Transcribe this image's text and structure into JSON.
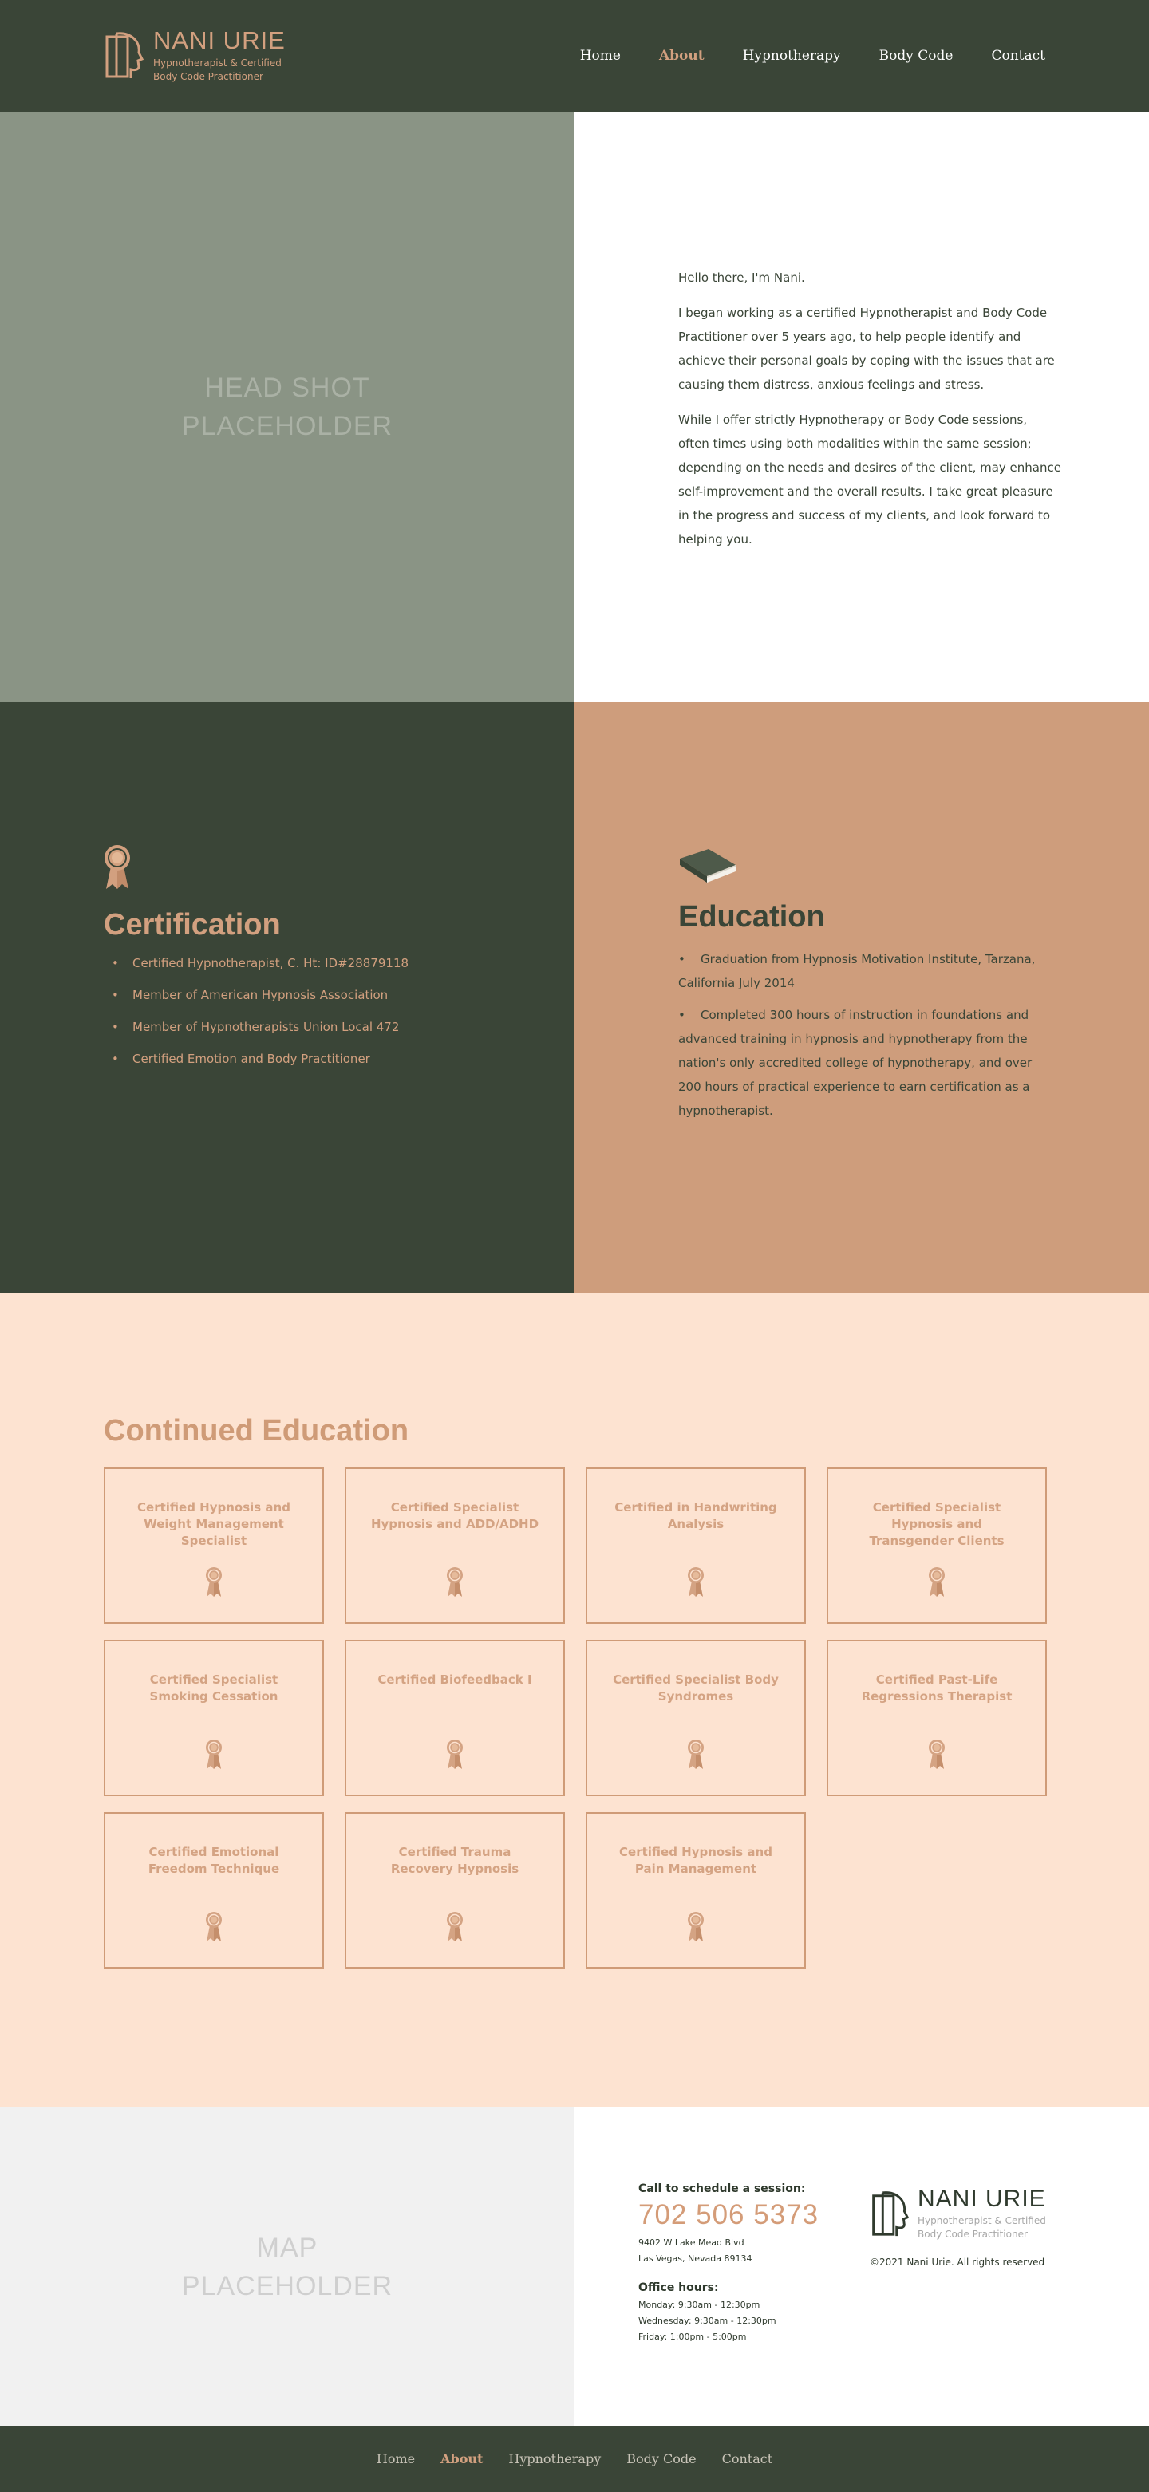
{
  "brand": {
    "name": "NANI URIE",
    "tagline_1": "Hypnotherapist & Certified",
    "tagline_2": "Body Code Practitioner"
  },
  "nav": [
    {
      "label": "Home",
      "active": false
    },
    {
      "label": "About",
      "active": true
    },
    {
      "label": "Hypnotherapy",
      "active": false
    },
    {
      "label": "Body Code",
      "active": false
    },
    {
      "label": "Contact",
      "active": false
    }
  ],
  "intro": {
    "headshot_placeholder": "HEAD SHOT\nPLACEHOLDER",
    "hello": "Hello there, I'm Nani.",
    "paragraph_1": "I began working as a certified Hypnotherapist and Body Code Practitioner over 5 years ago, to help people identify and achieve their personal goals by coping with the issues that are causing them distress, anxious feelings and stress.",
    "paragraph_2": "While I offer strictly Hypnotherapy or Body Code sessions, often times using both modalities within the same session; depending on the needs and desires of the client, may enhance self-improvement and the overall results. I take great pleasure in the progress and success of my clients, and look forward to helping you."
  },
  "certification": {
    "icon": "award-ribbon-icon",
    "title": "Certification",
    "items": [
      "Certified Hypnotherapist, C. Ht: ID#28879118",
      "Member of American Hypnosis Association",
      "Member of Hypnotherapists Union Local 472",
      "Certified Emotion and Body Practitioner"
    ]
  },
  "education": {
    "icon": "book-icon",
    "title": "Education",
    "items": [
      "Graduation from Hypnosis Motivation Institute, Tarzana, California July 2014",
      "Completed 300 hours of instruction in foundations and advanced training in hypnosis and hypnotherapy from the nation's only accredited college of hypnotherapy, and over 200 hours of practical experience to earn certification as a hypnotherapist."
    ]
  },
  "continued_education": {
    "title": "Continued Education",
    "cards": [
      "Certified Hypnosis and Weight Management Specialist",
      "Certified Specialist Hypnosis and ADD/ADHD",
      "Certified in Handwriting Analysis",
      "Certified Specialist Hypnosis and Transgender Clients",
      "Certified Specialist Smoking Cessation",
      "Certified Biofeedback I",
      "Certified Specialist Body Syndromes",
      "Certified Past-Life Regressions Therapist",
      "Certified Emotional Freedom Technique",
      "Certified Trauma Recovery Hypnosis",
      "Certified Hypnosis and Pain Management"
    ]
  },
  "contact": {
    "map_placeholder": "MAP\nPLACEHOLDER",
    "call_label": "Call to schedule a session:",
    "phone": "702 506 5373",
    "address_1": "9402 W Lake Mead Blvd",
    "address_2": "Las Vegas, Nevada 89134",
    "hours_label": "Office hours:",
    "hours": [
      "Monday: 9:30am - 12:30pm",
      "Wednesday: 9:30am - 12:30pm",
      "Friday: 1:00pm - 5:00pm"
    ],
    "copyright": "©2021 Nani Urie. All rights reserved"
  },
  "colors": {
    "dark_green": "#3a4537",
    "accent_tan": "#d2a07f",
    "peach_bg": "#fde3d1",
    "education_bg": "#ce9d7c",
    "headshot_bg": "#8a9485"
  }
}
